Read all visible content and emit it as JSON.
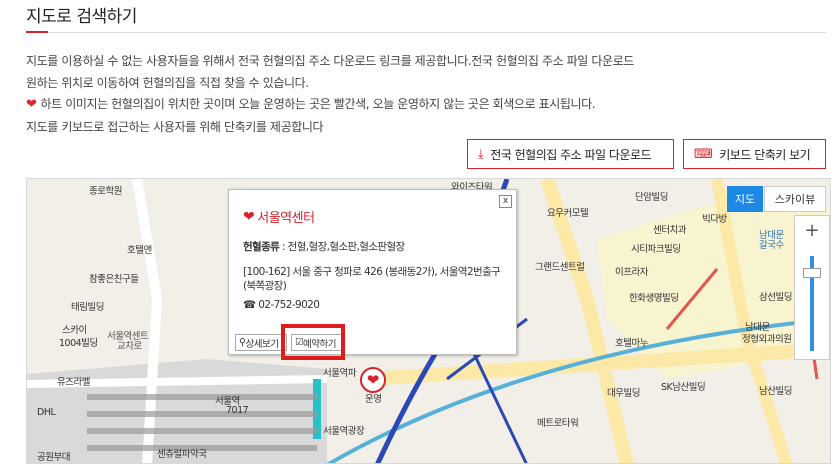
{
  "header": {
    "title": "지도로 검색하기"
  },
  "description": {
    "line1": "지도를 이용하실 수 없는 사용자들을 위해서 전국 헌혈의집 주소 다운로드 링크를 제공합니다.전국 헌혈의집 주소 파일 다운로드",
    "line2": "원하는 위치로 이동하여 헌혈의집을 직접 찾을 수 있습니다.",
    "line3": "하트 이미지는 헌혈의집이 위치한 곳이며 오늘 운영하는 곳은 빨간색, 오늘 운영하지 않는 곳은 회색으로 표시됩니다.",
    "line4": "지도를 키보드로 접근하는 사용자를 위해 단축키를 제공합니다"
  },
  "buttons": {
    "download_label": "전국 헌혈의집 주소 파일 다운로드",
    "keyboard_label": "키보드 단축키 보기"
  },
  "map": {
    "type_map": "지도",
    "type_sky": "스카이뷰",
    "zoom_plus": "+",
    "labels": [
      "종로학원",
      "호텔앤",
      "참좋은친구들",
      "태림빌딩",
      "스카이",
      "1004빌딩",
      "서울역센트",
      "교차로",
      "유즈라벨",
      "DHL",
      "공원부대",
      "와이즈타워",
      "요우커모텔",
      "단암빌딩",
      "센터치과",
      "빅다방",
      "남대문",
      "갈국수",
      "그랜드센트럴",
      "시티파크빌딩",
      "이프라자",
      "한화생명빌딩",
      "삼선빌딩",
      "남대문",
      "정형외과의원",
      "호텔마누",
      "SK남산빌딩",
      "대우빌딩",
      "메트로타워",
      "남산빌딩",
      "서울역",
      "7017",
      "서울역광장",
      "센츄럴파약국",
      "서울역파",
      "운영"
    ]
  },
  "popup": {
    "title": "서울역센터",
    "type_label": "헌혈종류",
    "type_value": "전혈,혈장,혈소판,혈소판혈장",
    "address": "[100-162] 서울 중구 청파로 426 (봉래동2가), 서울역2번출구(북쪽광장)",
    "phone": "02-752-9020",
    "detail_label": "상세보기",
    "reserve_label": "예약하기",
    "close": "x"
  },
  "colors": {
    "accent": "#d6222a",
    "map_active": "#1e88e5"
  },
  "icons": {
    "heart": "heart-icon",
    "download": "download-icon",
    "keyboard": "keyboard-icon",
    "phone": "phone-icon",
    "search": "search-icon"
  }
}
